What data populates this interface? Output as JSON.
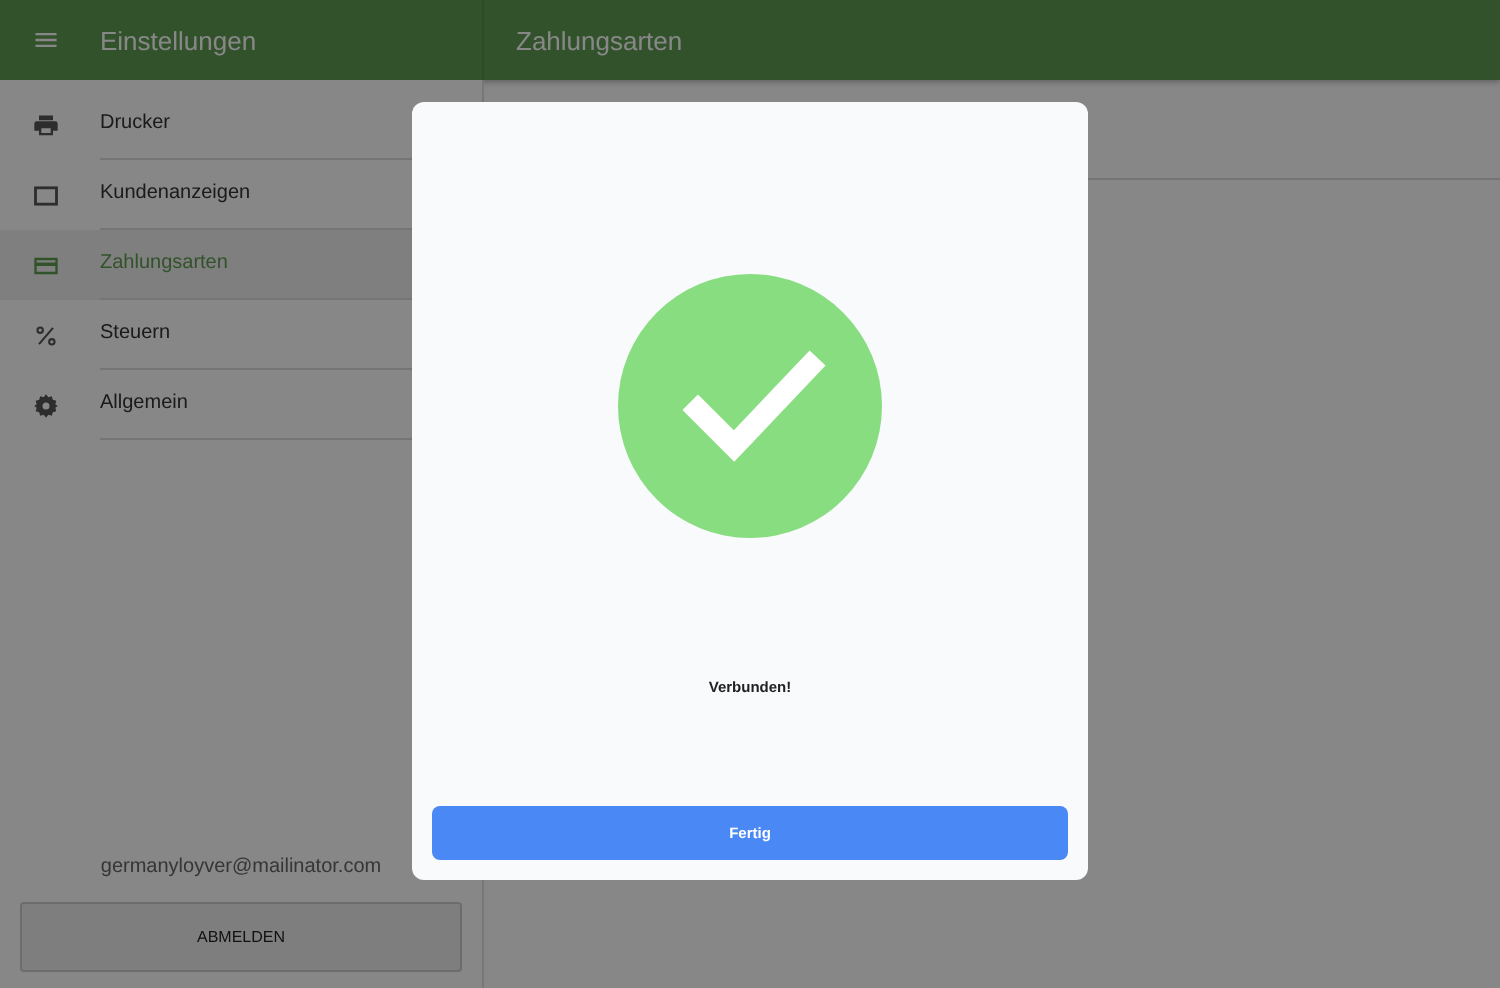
{
  "app_bar": {
    "title": "Einstellungen",
    "page_title": "Zahlungsarten"
  },
  "sidebar": {
    "items": [
      {
        "label": "Drucker",
        "selected": false
      },
      {
        "label": "Kundenanzeigen",
        "selected": false
      },
      {
        "label": "Zahlungsarten",
        "selected": true
      },
      {
        "label": "Steuern",
        "selected": false
      },
      {
        "label": "Allgemein",
        "selected": false
      }
    ],
    "account_email": "germanyloyver@mailinator.com",
    "logout_button": "ABMELDEN"
  },
  "dialog": {
    "message": "Verbunden!",
    "button": "Fertig"
  }
}
